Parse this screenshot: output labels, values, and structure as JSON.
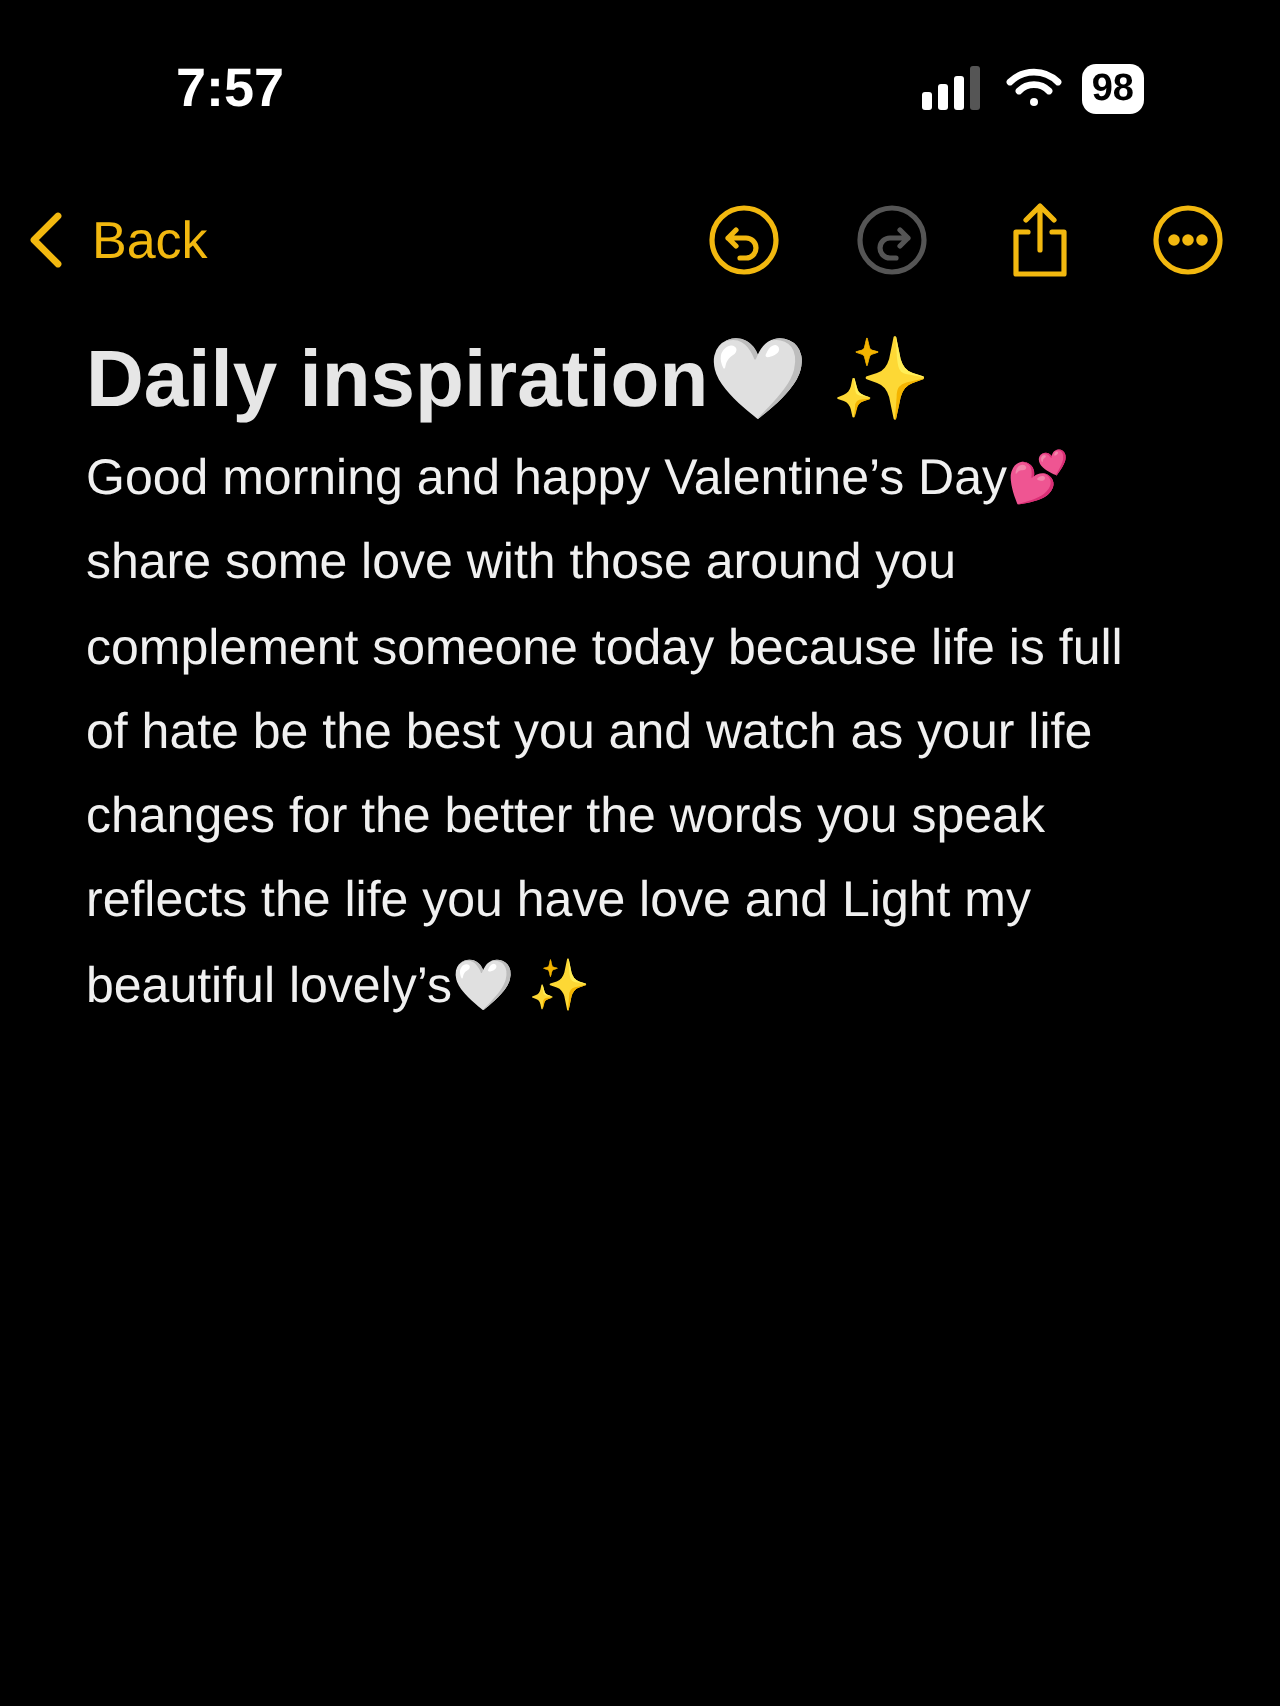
{
  "status_bar": {
    "time": "7:57",
    "battery": "98"
  },
  "nav": {
    "back": "Back",
    "actions": [
      {
        "kind": "undo",
        "disabled": false
      },
      {
        "kind": "redo",
        "disabled": true
      },
      {
        "kind": "share",
        "disabled": false
      },
      {
        "kind": "more",
        "disabled": false
      }
    ]
  },
  "note": {
    "title": "Daily inspiration🤍 ✨",
    "body": "Good morning and happy Valentine’s Day💕 share some love with those around you complement someone today because life is full of hate be the best you and watch as your life changes for the better the words you speak reflects the life you have love and Light my beautiful lovely’s🤍 ✨"
  }
}
